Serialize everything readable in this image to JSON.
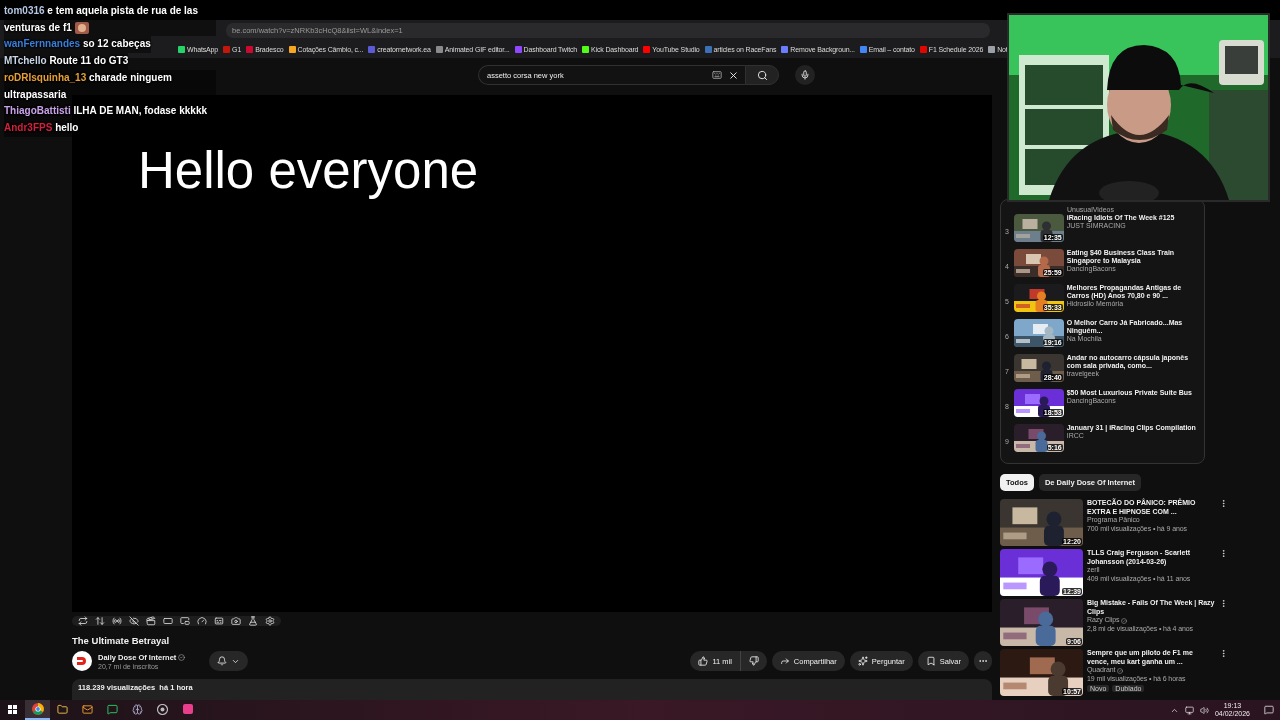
{
  "chat": [
    {
      "user": "tom0316",
      "color": "#b4c6e4",
      "message": "e tem aquela pista de rua de las venturas de f1",
      "emote": true
    },
    {
      "user": "wanFernnandes",
      "color": "#3a7fdc",
      "message": "so 12 cabeças",
      "emote": false
    },
    {
      "user": "MTchello",
      "color": "#c8d6e6",
      "message": "Route 11 do GT3",
      "emote": false
    },
    {
      "user": "roDRIsquinha_13",
      "color": "#e8a035",
      "message": "charade ninguem ultrapassaria",
      "emote": false
    },
    {
      "user": "ThiagoBattisti",
      "color": "#c9a3ea",
      "message": "ILHA DE MAN, fodase kkkkk",
      "emote": false
    },
    {
      "user": "Andr3FPS",
      "color": "#d2203f",
      "message": "hello",
      "emote": false
    }
  ],
  "browser": {
    "url": "be.com/watch?v=zNRKb3cHcQ8&list=WL&index=1",
    "bookmarks": [
      {
        "label": "WhatsApp",
        "color": "#25d366"
      },
      {
        "label": "G1",
        "color": "#c4170c"
      },
      {
        "label": "Bradesco",
        "color": "#cc092f"
      },
      {
        "label": "Cotações Câmbio, c...",
        "color": "#f5a623"
      },
      {
        "label": "creatornetwork.ea",
        "color": "#5b5bd6"
      },
      {
        "label": "Animated GIF editor...",
        "color": "#8a8a8a"
      },
      {
        "label": "Dashboard Twitch",
        "color": "#9146ff"
      },
      {
        "label": "Kick Dashboard",
        "color": "#53fc18"
      },
      {
        "label": "YouTube Studio",
        "color": "#ff0000"
      },
      {
        "label": "articles on RaceFans",
        "color": "#3b6fb6"
      },
      {
        "label": "Remove Backgroun...",
        "color": "#6b7cff"
      },
      {
        "label": "Email – contato",
        "color": "#4285f4"
      },
      {
        "label": "F1 Schedule 2026",
        "color": "#e10600"
      },
      {
        "label": "Not",
        "color": "#9aa0a6"
      }
    ]
  },
  "search": {
    "value": "assetto corsa new york"
  },
  "player": {
    "caption": "Hello everyone"
  },
  "video": {
    "title": "The Ultimate Betrayal",
    "channel": "Daily Dose Of Internet",
    "verified": true,
    "subscribers": "20,7 mi de inscritos",
    "likes": "11 mil",
    "actions": [
      {
        "kind": "share",
        "label": "Compartilhar"
      },
      {
        "kind": "ask",
        "label": "Perguntar"
      },
      {
        "kind": "save",
        "label": "Salvar"
      }
    ],
    "views": "118.239 visualizações",
    "age": "há 1 hora"
  },
  "playlist": [
    {
      "channel": "UnusualVideos"
    },
    {
      "index": "3",
      "title": "iRacing Idiots Of The Week #125",
      "channel": "JUST SIMRACING",
      "duration": "12:35"
    },
    {
      "index": "4",
      "title": "Eating $40 Business Class Train Singapore to Malaysia",
      "channel": "DancingBacons",
      "duration": "25:59"
    },
    {
      "index": "5",
      "title": "Melhores Propagandas Antigas de Carros (HD) Anos 70,80 e 90 ...",
      "channel": "Hidrosilo Memória",
      "duration": "35:33"
    },
    {
      "index": "6",
      "title": "O Melhor Carro Já Fabricado...Mas Ninguém...",
      "channel": "Na Mochila",
      "duration": "19:16"
    },
    {
      "index": "7",
      "title": "Andar no autocarro cápsula japonês com sala privada, como...",
      "channel": "travelgeek",
      "duration": "28:40"
    },
    {
      "index": "8",
      "title": "$50 Most Luxurious Private Suite Bus",
      "channel": "DancingBacons",
      "duration": "18:53"
    },
    {
      "index": "9",
      "title": "January 31 | iRacing Clips Compilation",
      "channel": "IRCC",
      "duration": "5:16"
    }
  ],
  "chips": [
    {
      "label": "Todos",
      "selected": true
    },
    {
      "label": "De Daily Dose Of Internet",
      "selected": false
    }
  ],
  "recommendations": [
    {
      "title": "BOTECÃO DO PÂNICO: PRÊMIO EXTRA E HIPNOSE COM ...",
      "channel": "Programa Pânico",
      "verified": false,
      "stats": "700 mil visualizações • há 9 anos",
      "duration": "12:20"
    },
    {
      "title": "TLLS Craig Ferguson - Scarlett Johansson (2014-03-26)",
      "channel": "zerll",
      "verified": false,
      "stats": "409 mil visualizações • há 11 anos",
      "duration": "12:39"
    },
    {
      "title": "Big Mistake - Fails Of The Week | Razy Clips",
      "channel": "Razy Clips",
      "verified": true,
      "stats": "2,8 mi de visualizações • há 4 anos",
      "duration": "9:06"
    },
    {
      "title": "Sempre que um piloto de F1 me vence, meu kart ganha um ...",
      "channel": "Quadrant",
      "verified": true,
      "stats": "19 mil visualizações • há 6 horas",
      "duration": "10:57",
      "badges": [
        "Novo",
        "Dublado"
      ]
    }
  ],
  "taskbar": {
    "apps": [
      {
        "kind": "chrome",
        "active": true
      },
      {
        "kind": "folder",
        "active": false
      },
      {
        "kind": "mail",
        "active": false
      },
      {
        "kind": "whatsapp",
        "active": false
      },
      {
        "kind": "brain",
        "active": false
      },
      {
        "kind": "obs",
        "active": false
      },
      {
        "kind": "app",
        "active": false
      }
    ],
    "time": "19:13",
    "date": "04/02/2026"
  }
}
